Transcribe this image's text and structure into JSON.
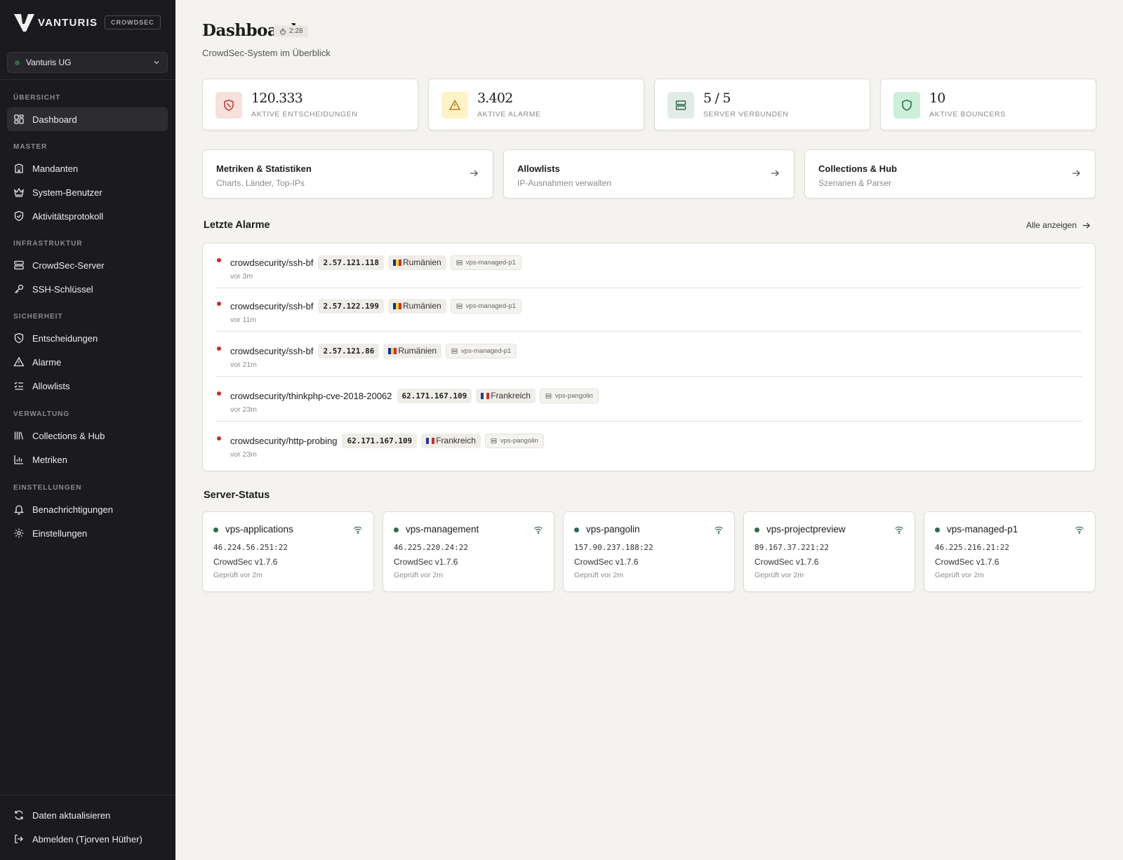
{
  "sidebar": {
    "brand": "VANTURIS",
    "brand_tag": "CROWDSEC",
    "tenant": "Vanturis UG",
    "sections": {
      "overview": "ÜBERSICHT",
      "master": "MASTER",
      "infra": "INFRASTRUKTUR",
      "security": "SICHERHEIT",
      "admin": "VERWALTUNG",
      "settings": "EINSTELLUNGEN"
    },
    "items": {
      "dashboard": "Dashboard",
      "tenants": "Mandanten",
      "system_users": "System-Benutzer",
      "activity_log": "Aktivitätsprotokoll",
      "servers": "CrowdSec-Server",
      "ssh_keys": "SSH-Schlüssel",
      "decisions": "Entscheidungen",
      "alarms": "Alarme",
      "allowlists": "Allowlists",
      "collections": "Collections & Hub",
      "metrics": "Metriken",
      "notifications": "Benachrichtigungen",
      "settings": "Einstellungen",
      "refresh": "Daten aktualisieren",
      "logout": "Abmelden (Tjorven Hüther)"
    }
  },
  "header": {
    "title": "Dashboard",
    "timer": "2:28",
    "subtitle": "CrowdSec-System im Überblick"
  },
  "stats": [
    {
      "value": "120.333",
      "label": "AKTIVE ENTSCHEIDUNGEN"
    },
    {
      "value": "3.402",
      "label": "AKTIVE ALARME"
    },
    {
      "value": "5 / 5",
      "label": "SERVER VERBUNDEN"
    },
    {
      "value": "10",
      "label": "AKTIVE BOUNCERS"
    }
  ],
  "quick_links": [
    {
      "title": "Metriken & Statistiken",
      "subtitle": "Charts, Länder, Top-IPs"
    },
    {
      "title": "Allowlists",
      "subtitle": "IP-Ausnahmen verwalten"
    },
    {
      "title": "Collections & Hub",
      "subtitle": "Szenarien & Parser"
    }
  ],
  "alarms": {
    "title": "Letzte Alarme",
    "show_all": "Alle anzeigen",
    "rows": [
      {
        "scenario": "crowdsecurity/ssh-bf",
        "ip": "2.57.121.118",
        "country": "Rumänien",
        "server": "vps-managed-p1",
        "time": "vor 3m"
      },
      {
        "scenario": "crowdsecurity/ssh-bf",
        "ip": "2.57.122.199",
        "country": "Rumänien",
        "server": "vps-managed-p1",
        "time": "vor 11m"
      },
      {
        "scenario": "crowdsecurity/ssh-bf",
        "ip": "2.57.121.86",
        "country": "Rumänien",
        "server": "vps-managed-p1",
        "time": "vor 21m"
      },
      {
        "scenario": "crowdsecurity/thinkphp-cve-2018-20062",
        "ip": "62.171.167.109",
        "country": "Frankreich",
        "server": "vps-pangolin",
        "time": "vor 23m"
      },
      {
        "scenario": "crowdsecurity/http-probing",
        "ip": "62.171.167.109",
        "country": "Frankreich",
        "server": "vps-pangolin",
        "time": "vor 23m"
      }
    ]
  },
  "server_status": {
    "title": "Server-Status",
    "servers": [
      {
        "name": "vps-applications",
        "address": "46.224.56.251:22",
        "version": "CrowdSec v1.7.6",
        "checked": "Geprüft vor 2m"
      },
      {
        "name": "vps-management",
        "address": "46.225.220.24:22",
        "version": "CrowdSec v1.7.6",
        "checked": "Geprüft vor 2m"
      },
      {
        "name": "vps-pangolin",
        "address": "157.90.237.188:22",
        "version": "CrowdSec v1.7.6",
        "checked": "Geprüft vor 2m"
      },
      {
        "name": "vps-projectpreview",
        "address": "89.167.37.221:22",
        "version": "CrowdSec v1.7.6",
        "checked": "Geprüft vor 2m"
      },
      {
        "name": "vps-managed-p1",
        "address": "46.225.216.21:22",
        "version": "CrowdSec v1.7.6",
        "checked": "Geprüft vor 2m"
      }
    ]
  },
  "colors": {
    "sidebar_bg": "#1b1b1f",
    "page_bg": "#f4f3ef",
    "alarm_dot": "#c4302b",
    "online_dot": "#2f6b4a",
    "decisions_icon_bg": "#f6e1dc",
    "alarms_icon_bg": "#fdf3c4",
    "servers_icon_bg": "#e2ece7",
    "bouncers_icon_bg": "#cdeed9"
  }
}
